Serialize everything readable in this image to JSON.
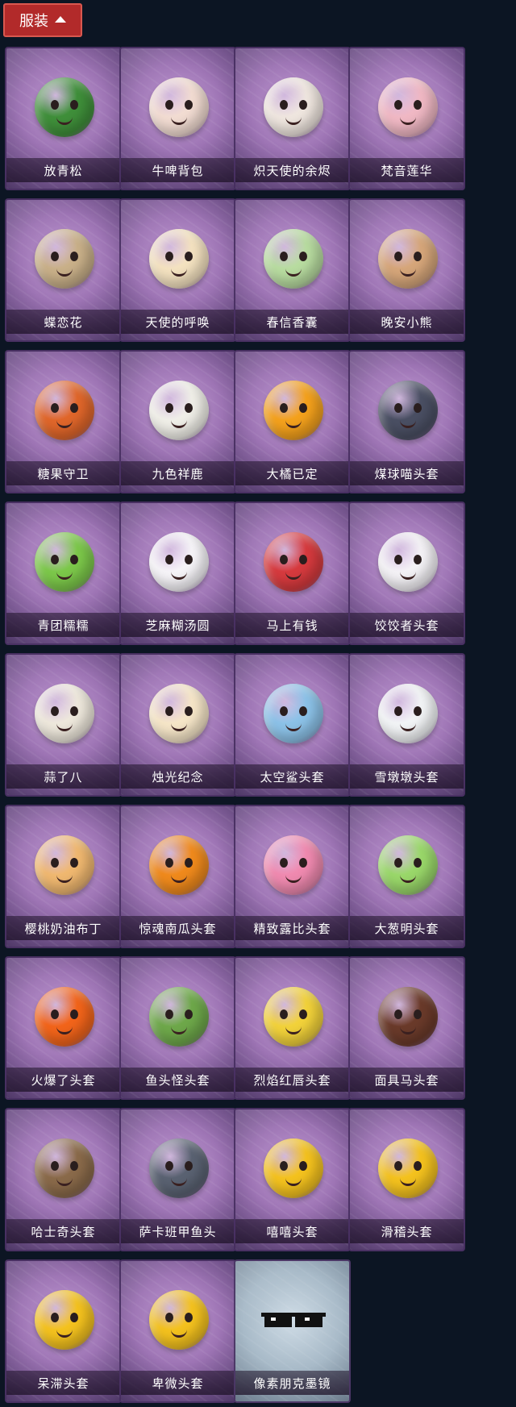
{
  "header": {
    "tab_label": "服装"
  },
  "items": [
    {
      "name": "放青松",
      "icon": "pine-bonsai-icon",
      "color": "#3f8f3a",
      "style": "purple"
    },
    {
      "name": "牛啤背包",
      "icon": "cow-beer-barrel-icon",
      "color": "#f2dcd2",
      "style": "purple"
    },
    {
      "name": "炽天使的余烬",
      "icon": "angel-doll-icon",
      "color": "#efe6df",
      "style": "purple"
    },
    {
      "name": "梵音莲华",
      "icon": "lotus-doll-icon",
      "color": "#f0b8c4",
      "style": "purple"
    },
    {
      "name": "蝶恋花",
      "icon": "butterfly-bell-wreath-icon",
      "color": "#c9b089",
      "style": "purple"
    },
    {
      "name": "天使的呼唤",
      "icon": "angel-charm-icon",
      "color": "#f4e2c0",
      "style": "purple"
    },
    {
      "name": "春信香囊",
      "icon": "green-sachet-icon",
      "color": "#b8dca0",
      "style": "purple"
    },
    {
      "name": "晚安小熊",
      "icon": "teddy-bear-charm-icon",
      "color": "#d6a67a",
      "style": "purple"
    },
    {
      "name": "糖果守卫",
      "icon": "pumpkin-scarecrow-icon",
      "color": "#e0662a",
      "style": "purple"
    },
    {
      "name": "九色祥鹿",
      "icon": "white-deer-icon",
      "color": "#f0efe8",
      "style": "purple"
    },
    {
      "name": "大橘已定",
      "icon": "orange-slice-icon",
      "color": "#f4a11c",
      "style": "purple"
    },
    {
      "name": "煤球喵头套",
      "icon": "cat-head-icon",
      "color": "#4a4f63",
      "style": "purple"
    },
    {
      "name": "青团糯糯",
      "icon": "green-rice-ball-icon",
      "color": "#7cc84a",
      "style": "purple"
    },
    {
      "name": "芝麻糊汤圆",
      "icon": "white-dumpling-icon",
      "color": "#f6f4f8",
      "style": "purple"
    },
    {
      "name": "马上有钱",
      "icon": "red-horse-head-icon",
      "color": "#d63a3e",
      "style": "purple"
    },
    {
      "name": "饺饺者头套",
      "icon": "dumpling-head-icon",
      "color": "#f4f2f6",
      "style": "purple"
    },
    {
      "name": "蒜了八",
      "icon": "garlic-head-icon",
      "color": "#eee8dc",
      "style": "purple"
    },
    {
      "name": "烛光纪念",
      "icon": "candle-head-icon",
      "color": "#f6e6c8",
      "style": "purple"
    },
    {
      "name": "太空鲨头套",
      "icon": "shark-head-icon",
      "color": "#8cc2e8",
      "style": "purple"
    },
    {
      "name": "雪墩墩头套",
      "icon": "snowman-head-icon",
      "color": "#f2f4f6",
      "style": "purple"
    },
    {
      "name": "樱桃奶油布丁",
      "icon": "pudding-head-icon",
      "color": "#f0b870",
      "style": "purple"
    },
    {
      "name": "惊魂南瓜头套",
      "icon": "pumpkin-head-icon",
      "color": "#f08a1c",
      "style": "purple"
    },
    {
      "name": "精致露比头套",
      "icon": "pink-beaver-head-icon",
      "color": "#f08ab0",
      "style": "purple"
    },
    {
      "name": "大葱明头套",
      "icon": "scallion-head-icon",
      "color": "#9ad86a",
      "style": "purple"
    },
    {
      "name": "火爆了头套",
      "icon": "fireball-head-icon",
      "color": "#f2641a",
      "style": "purple"
    },
    {
      "name": "鱼头怪头套",
      "icon": "fish-head-icon",
      "color": "#6ea84a",
      "style": "purple"
    },
    {
      "name": "烈焰红唇头套",
      "icon": "pikachu-sunglasses-head-icon",
      "color": "#f2d23a",
      "style": "purple"
    },
    {
      "name": "面具马头套",
      "icon": "horse-mask-icon",
      "color": "#6a3a2a",
      "style": "purple"
    },
    {
      "name": "哈士奇头套",
      "icon": "husky-sunglasses-head-icon",
      "color": "#8a6a4a",
      "style": "purple"
    },
    {
      "name": "萨卡班甲鱼头",
      "icon": "sacabambaspis-head-icon",
      "color": "#5a6272",
      "style": "purple"
    },
    {
      "name": "嘻嘻头套",
      "icon": "grin-emoji-head-icon",
      "color": "#f4c21e",
      "style": "purple"
    },
    {
      "name": "滑稽头套",
      "icon": "smirk-emoji-head-icon",
      "color": "#f4c21e",
      "style": "purple"
    },
    {
      "name": "呆滞头套",
      "icon": "stunned-emoji-head-icon",
      "color": "#f4c21e",
      "style": "purple"
    },
    {
      "name": "卑微头套",
      "icon": "humble-emoji-head-icon",
      "color": "#f4c21e",
      "style": "purple"
    },
    {
      "name": "像素朋克墨镜",
      "icon": "pixel-sunglasses-icon",
      "color": "#111111",
      "style": "silver"
    }
  ]
}
